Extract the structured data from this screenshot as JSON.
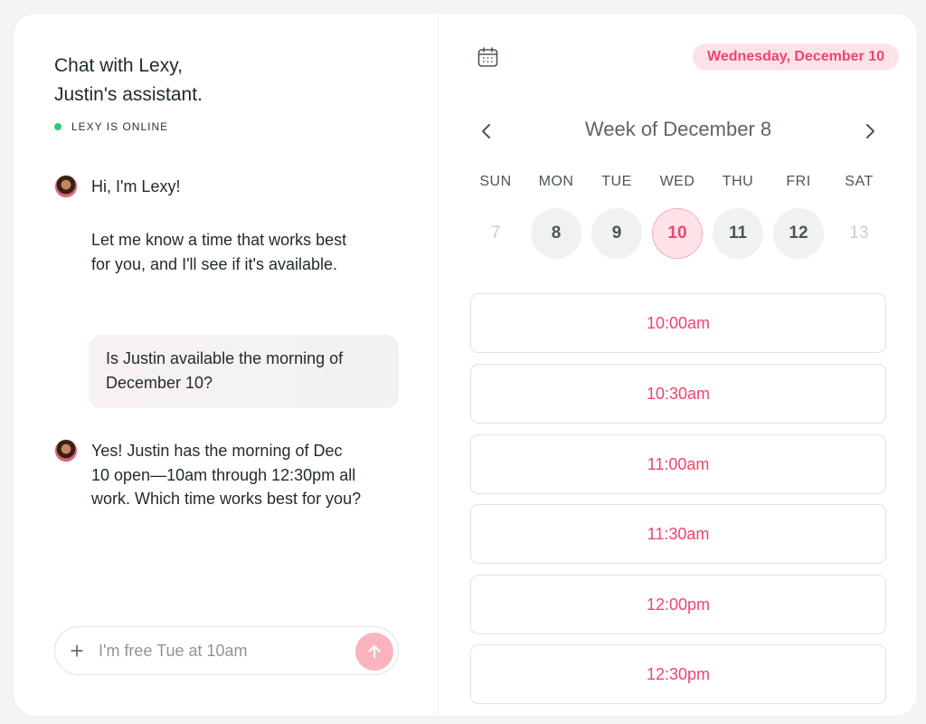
{
  "chat": {
    "title_line1": "Chat with Lexy,",
    "title_line2": "Justin's assistant.",
    "status": "LEXY IS ONLINE",
    "messages": [
      {
        "from": "assistant",
        "text": "Hi, I'm Lexy!"
      },
      {
        "from": "assistant",
        "text": "Let me know a time that works best for you, and I'll see if it's available."
      },
      {
        "from": "user",
        "text": "Is Justin available the morning of December 10?"
      },
      {
        "from": "assistant",
        "text": "Yes! Justin has the morning of Dec 10 open—10am through 12:30pm all work. Which time works best for you?"
      }
    ],
    "composer_placeholder": "I'm free Tue at 10am"
  },
  "calendar": {
    "selected_date_label": "Wednesday, December 10",
    "week_title": "Week of December 8",
    "days": [
      {
        "name": "SUN",
        "num": "7",
        "state": "disabled"
      },
      {
        "name": "MON",
        "num": "8",
        "state": "available"
      },
      {
        "name": "TUE",
        "num": "9",
        "state": "available"
      },
      {
        "name": "WED",
        "num": "10",
        "state": "selected"
      },
      {
        "name": "THU",
        "num": "11",
        "state": "available"
      },
      {
        "name": "FRI",
        "num": "12",
        "state": "available"
      },
      {
        "name": "SAT",
        "num": "13",
        "state": "disabled"
      }
    ],
    "slots": [
      "10:00am",
      "10:30am",
      "11:00am",
      "11:30am",
      "12:00pm",
      "12:30pm"
    ]
  },
  "colors": {
    "accent": "#f0456c",
    "accent_light": "#fde3e8",
    "online": "#2ecc71"
  }
}
